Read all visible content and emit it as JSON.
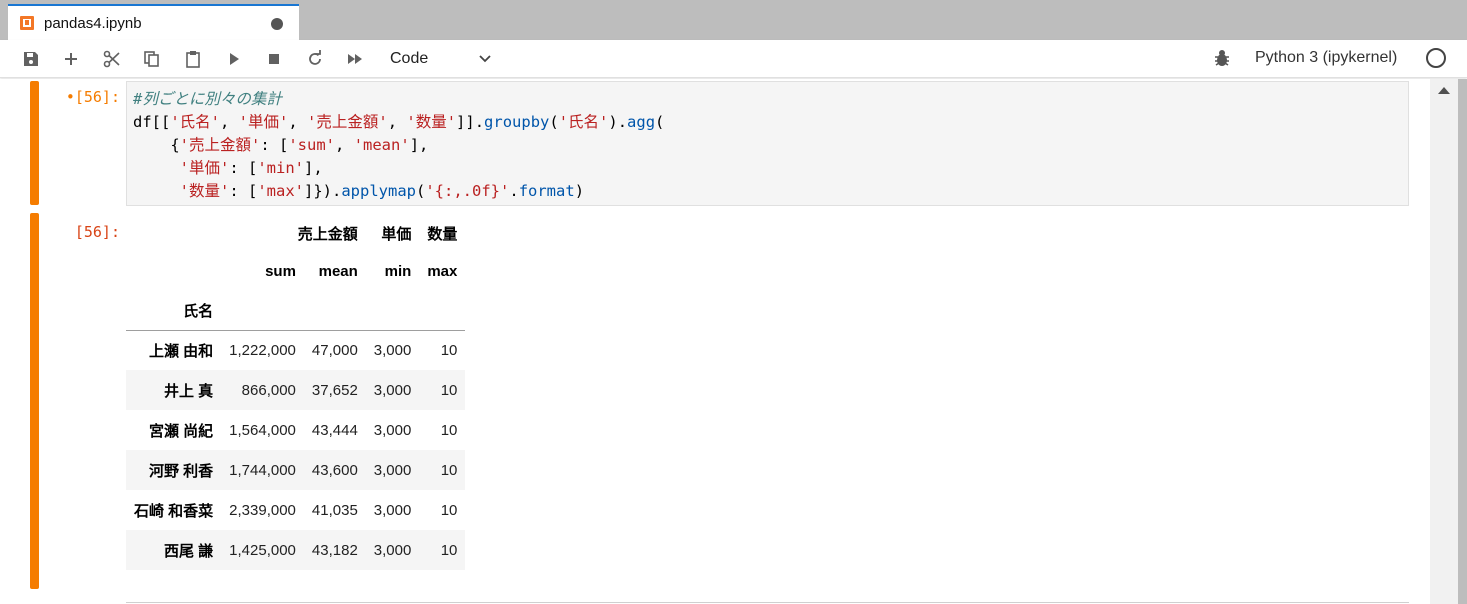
{
  "tab": {
    "title": "pandas4.ipynb"
  },
  "toolbar": {
    "cell_type": "Code",
    "kernel_name": "Python 3 (ipykernel)"
  },
  "cell": {
    "in_prompt": "•[56]:",
    "out_prompt": "[56]:",
    "code": {
      "comment": "#列ごとに別々の集計",
      "line2_a": "df[[",
      "line2_s1": "'氏名'",
      "line2_b": ", ",
      "line2_s2": "'単価'",
      "line2_c": ", ",
      "line2_s3": "'売上金額'",
      "line2_d": ", ",
      "line2_s4": "'数量'",
      "line2_e": "]].",
      "line2_fn1": "groupby",
      "line2_f": "(",
      "line2_s5": "'氏名'",
      "line2_g": ").",
      "line2_fn2": "agg",
      "line2_h": "(",
      "line3_a": "    {",
      "line3_s1": "'売上金額'",
      "line3_b": ": [",
      "line3_s2": "'sum'",
      "line3_c": ", ",
      "line3_s3": "'mean'",
      "line3_d": "],",
      "line4_a": "     ",
      "line4_s1": "'単価'",
      "line4_b": ": [",
      "line4_s2": "'min'",
      "line4_c": "],",
      "line5_a": "     ",
      "line5_s1": "'数量'",
      "line5_b": ": [",
      "line5_s2": "'max'",
      "line5_c": "]}).",
      "line5_fn1": "applymap",
      "line5_d": "(",
      "line5_s3": "'{:,.0f}'",
      "line5_e": ".",
      "line5_fn2": "format",
      "line5_f": ")"
    }
  },
  "dataframe": {
    "col_level0": [
      "売上金額",
      "単価",
      "数量"
    ],
    "col_level1": [
      "sum",
      "mean",
      "min",
      "max"
    ],
    "index_name": "氏名",
    "rows": [
      {
        "name": "上瀬 由和",
        "values": [
          "1,222,000",
          "47,000",
          "3,000",
          "10"
        ]
      },
      {
        "name": "井上 真",
        "values": [
          "866,000",
          "37,652",
          "3,000",
          "10"
        ]
      },
      {
        "name": "宮瀬 尚紀",
        "values": [
          "1,564,000",
          "43,444",
          "3,000",
          "10"
        ]
      },
      {
        "name": "河野 利香",
        "values": [
          "1,744,000",
          "43,600",
          "3,000",
          "10"
        ]
      },
      {
        "name": "石崎 和香菜",
        "values": [
          "2,339,000",
          "41,035",
          "3,000",
          "10"
        ]
      },
      {
        "name": "西尾 謙",
        "values": [
          "1,425,000",
          "43,182",
          "3,000",
          "10"
        ]
      }
    ]
  },
  "icons": [
    "notebook-icon",
    "save-icon",
    "add-cell-icon",
    "cut-icon",
    "copy-icon",
    "paste-icon",
    "run-icon",
    "stop-icon",
    "restart-icon",
    "run-all-icon",
    "chevron-down-icon",
    "debugger-icon",
    "kernel-status-icon"
  ],
  "colors": {
    "accent": "#f57c00",
    "tab_border": "#1976d2",
    "string": "#ba2121",
    "function": "#0055aa",
    "comment": "#408080"
  }
}
